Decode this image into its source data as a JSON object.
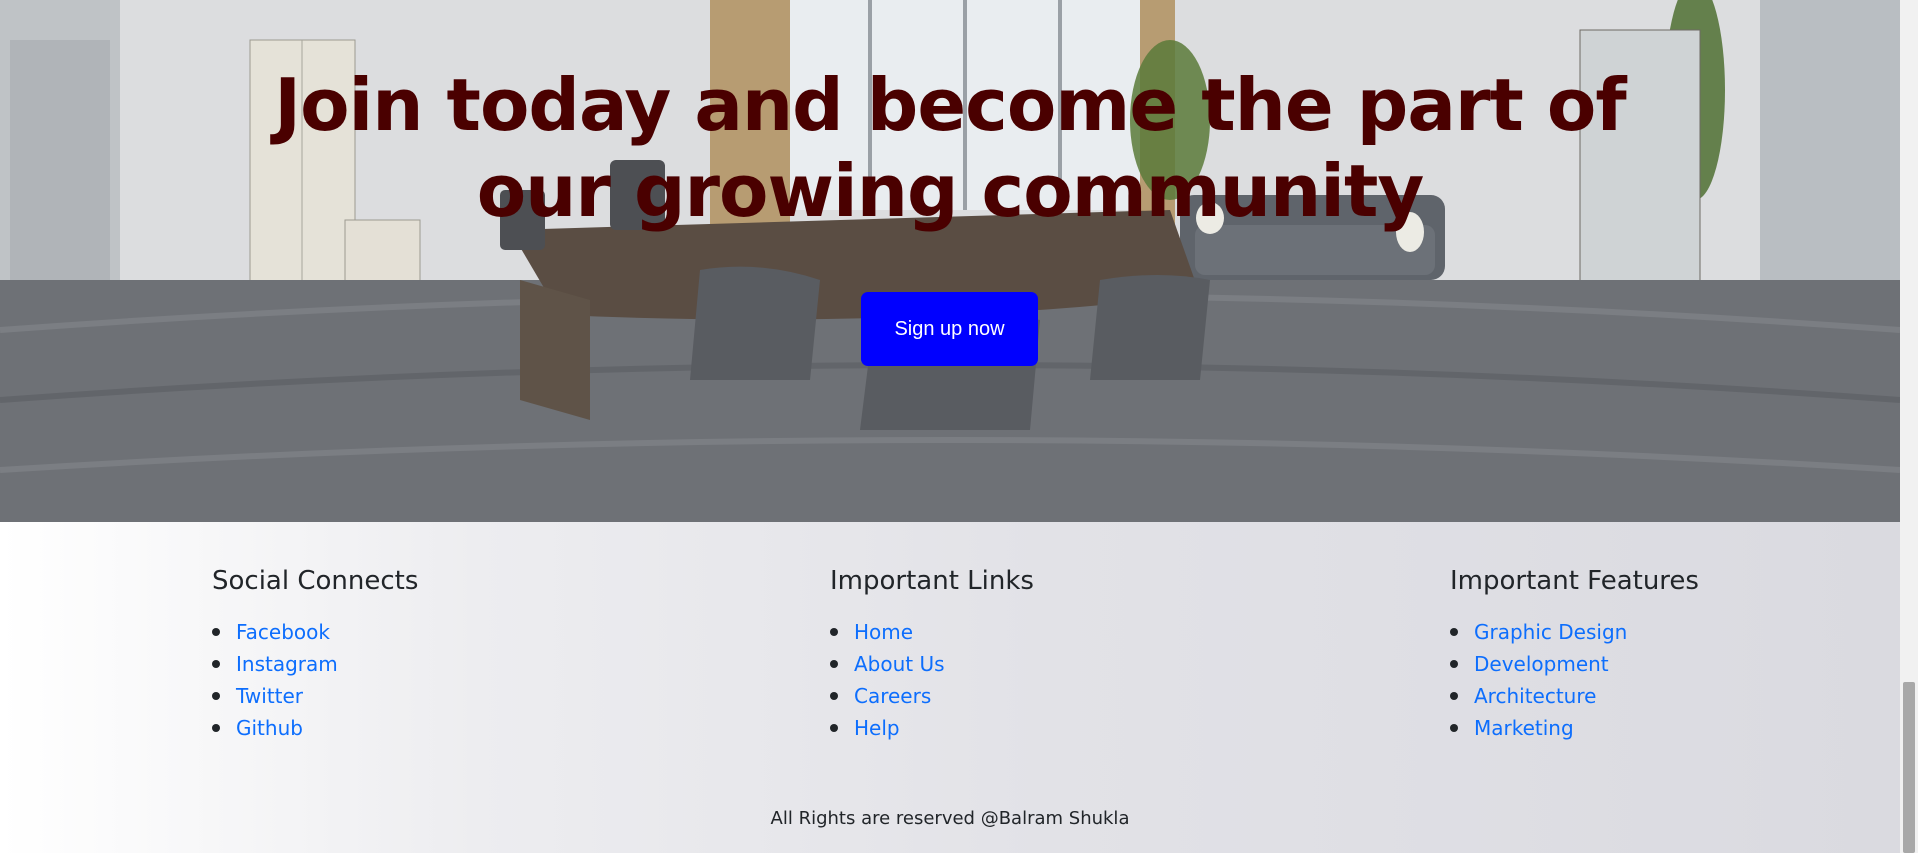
{
  "hero": {
    "title": "Join today and become the part of our growing community",
    "signup_label": "Sign up now"
  },
  "footer": {
    "columns": [
      {
        "heading": "Social Connects",
        "links": [
          "Facebook",
          "Instagram",
          "Twitter",
          "Github"
        ]
      },
      {
        "heading": "Important Links",
        "links": [
          "Home",
          "About Us",
          "Careers",
          "Help"
        ]
      },
      {
        "heading": "Important Features",
        "links": [
          "Graphic Design",
          "Development",
          "Architecture",
          "Marketing"
        ]
      }
    ],
    "copyright": "All Rights are reserved @Balram Shukla"
  },
  "colors": {
    "title": "#4a0000",
    "button": "#0000ff",
    "link": "#0d6efd"
  }
}
